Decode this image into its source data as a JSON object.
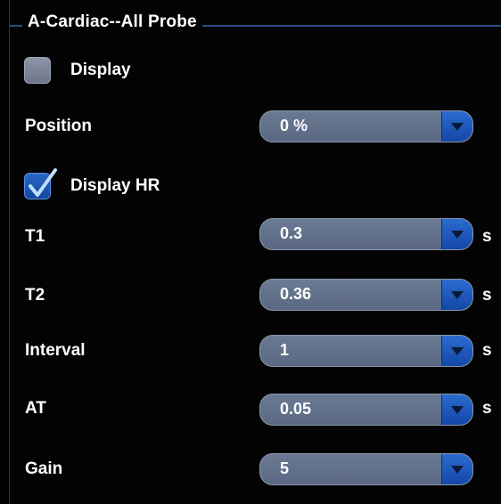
{
  "panel": {
    "title": "A-Cardiac--All Probe",
    "display_checkbox": {
      "label": "Display",
      "checked": false
    },
    "position": {
      "label": "Position",
      "value": "0 %"
    },
    "display_hr_checkbox": {
      "label": "Display HR",
      "checked": true
    },
    "t1": {
      "label": "T1",
      "value": "0.3",
      "unit": "s"
    },
    "t2": {
      "label": "T2",
      "value": "0.36",
      "unit": "s"
    },
    "interval": {
      "label": "Interval",
      "value": "1",
      "unit": "s"
    },
    "at": {
      "label": "AT",
      "value": "0.05",
      "unit": "s"
    },
    "gain": {
      "label": "Gain",
      "value": "5"
    }
  },
  "colors": {
    "background": "#030303",
    "group_line": "#2c4a8f",
    "select_body": "#5f6d88",
    "dropdown_button": "#1d57b8",
    "checkbox_checked": "#1d57b8",
    "checkbox_unchecked": "#7a8397"
  },
  "icons": {
    "dropdown": "chevron-down-icon",
    "checkmark": "checkmark-icon"
  }
}
